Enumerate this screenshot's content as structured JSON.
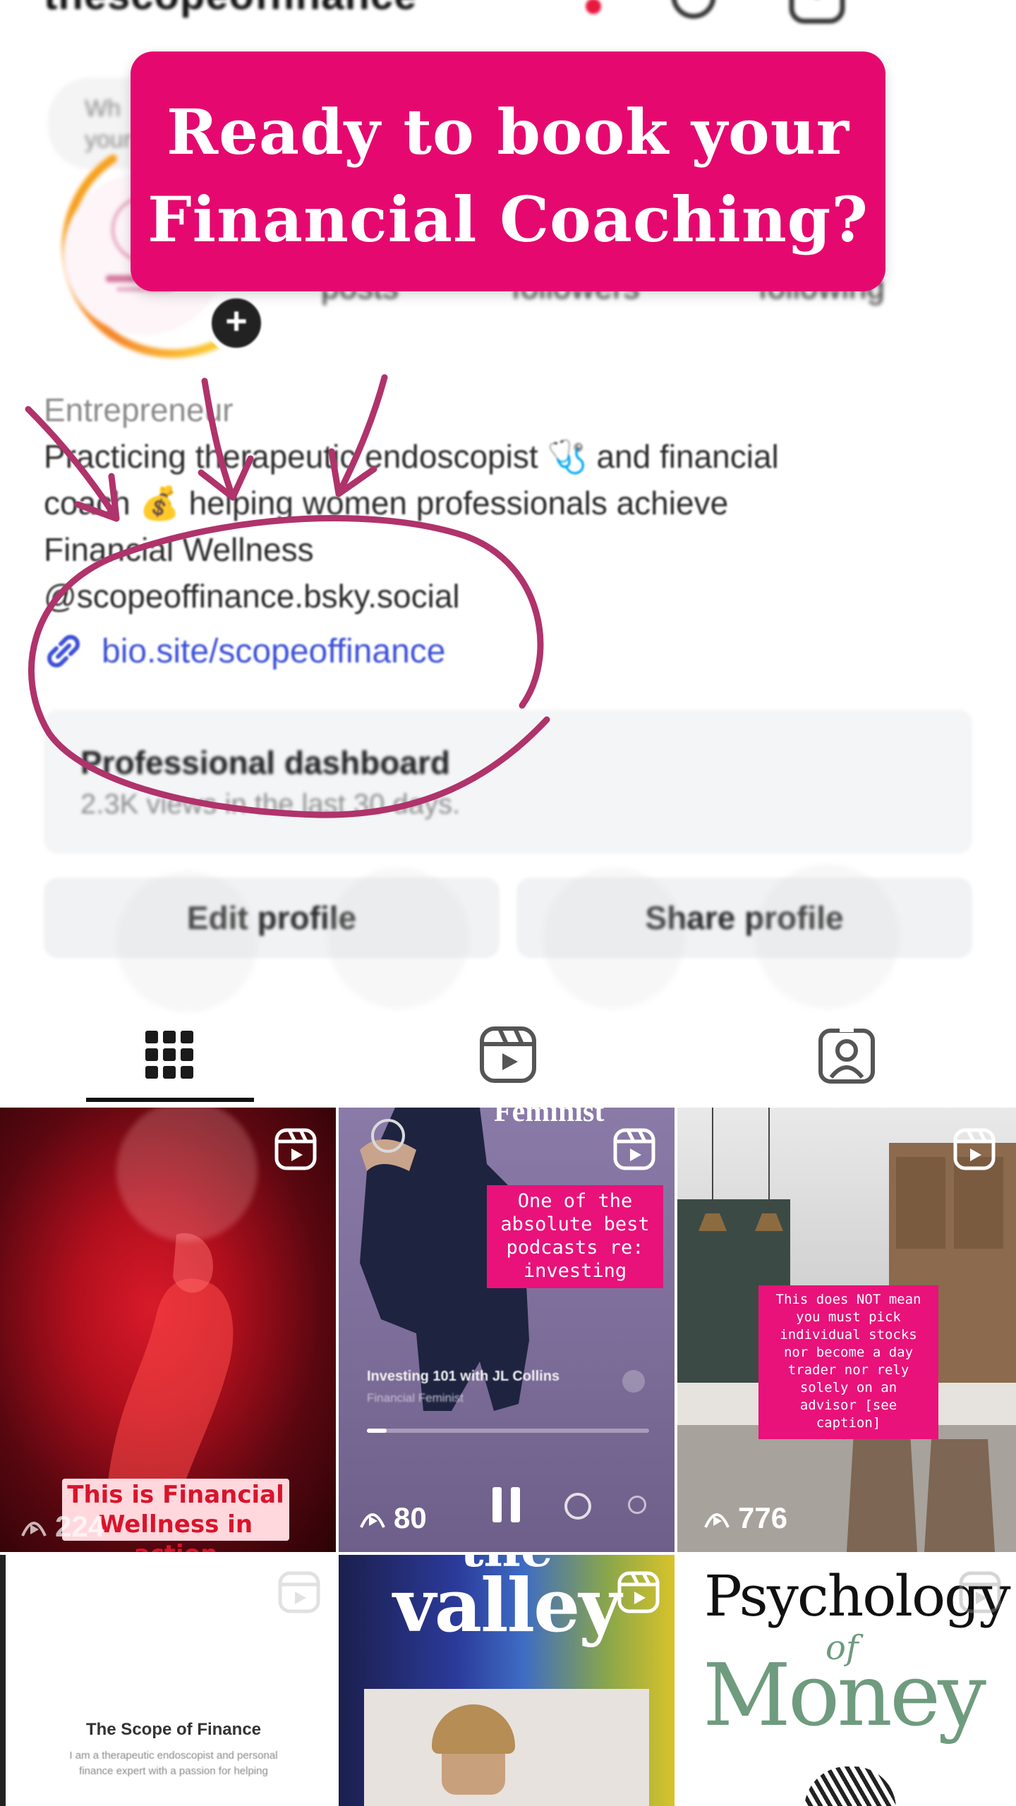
{
  "header": {
    "handle": "thescopeoffinance"
  },
  "story_note": {
    "text_line1": "Wh",
    "text_line2": "your"
  },
  "stats": {
    "posts_label": "posts",
    "followers_label": "followers",
    "following_label": "following"
  },
  "bio": {
    "category": "Entrepreneur",
    "line1": "Practicing therapeutic endoscopist 🩺 and financial",
    "line2": "coach 💰 helping women professionals achieve",
    "line3": "Financial Wellness",
    "line4": "@scopeoffinance.bsky.social",
    "link": "bio.site/scopeoffinance"
  },
  "dashboard": {
    "title": "Professional dashboard",
    "subtitle": "2.3K views in the last 30 days."
  },
  "buttons": {
    "edit": "Edit profile",
    "share": "Share profile"
  },
  "banner": {
    "line1": "Ready to book your",
    "line2": "Financial Coaching?"
  },
  "grid": {
    "post1": {
      "caption_line1": "This is Financial",
      "caption_line2": "Wellness in action",
      "views": "224"
    },
    "post2": {
      "top_text": "Feminist",
      "caption_line1": "One of the",
      "caption_line2": "absolute best",
      "caption_line3": "podcasts re:",
      "caption_line4": "investing",
      "episode": "Investing 101 with JL Collins",
      "show": "Financial Feminist",
      "views": "80"
    },
    "post3": {
      "caption_lines": [
        "This does NOT mean",
        "you must pick",
        "individual stocks",
        "nor become a day",
        "trader nor rely",
        "solely on an",
        "advisor [see",
        "caption]"
      ],
      "views": "776"
    },
    "post4": {
      "title": "The Scope of Finance",
      "sub1": "I am a therapeutic endoscopist and personal",
      "sub2": "finance expert with a passion for helping"
    },
    "post5": {
      "word1": "the",
      "word2": "valley"
    },
    "post6": {
      "word1": "Psychology",
      "word2": "of",
      "word3": "Money"
    }
  },
  "colors": {
    "banner": "#e5096f",
    "annotation": "#b0336b",
    "link": "#3b4fd9",
    "caption_pink": "#e8127a"
  }
}
